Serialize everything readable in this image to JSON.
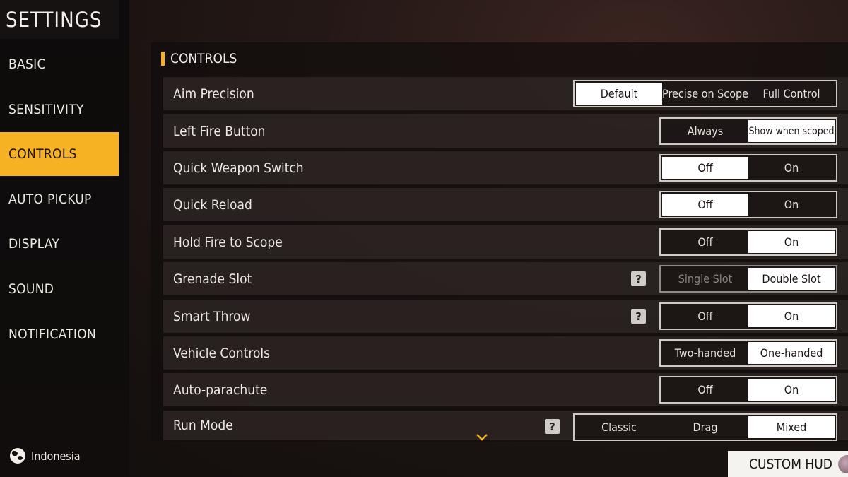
{
  "sidebar": {
    "title": "SETTINGS",
    "items": [
      {
        "label": "BASIC"
      },
      {
        "label": "SENSITIVITY"
      },
      {
        "label": "CONTROLS"
      },
      {
        "label": "AUTO PICKUP"
      },
      {
        "label": "DISPLAY"
      },
      {
        "label": "SOUND"
      },
      {
        "label": "NOTIFICATION"
      }
    ],
    "active_index": 2,
    "region": "Indonesia"
  },
  "section": {
    "title": "CONTROLS"
  },
  "rows": [
    {
      "label": "Aim Precision",
      "help": false,
      "options": [
        "Default",
        "Precise on Scope",
        "Full Control"
      ],
      "selected": 0
    },
    {
      "label": "Left Fire Button",
      "help": false,
      "options": [
        "Always",
        "Show when scoped"
      ],
      "selected": 1
    },
    {
      "label": "Quick Weapon Switch",
      "help": false,
      "options": [
        "Off",
        "On"
      ],
      "selected": 0
    },
    {
      "label": "Quick Reload",
      "help": false,
      "options": [
        "Off",
        "On"
      ],
      "selected": 0
    },
    {
      "label": "Hold Fire to Scope",
      "help": false,
      "options": [
        "Off",
        "On"
      ],
      "selected": 1
    },
    {
      "label": "Grenade Slot",
      "help": true,
      "options": [
        "Single Slot",
        "Double Slot"
      ],
      "selected": 1
    },
    {
      "label": "Smart Throw",
      "help": true,
      "options": [
        "Off",
        "On"
      ],
      "selected": 1
    },
    {
      "label": "Vehicle Controls",
      "help": false,
      "options": [
        "Two-handed",
        "One-handed"
      ],
      "selected": 1
    },
    {
      "label": "Auto-parachute",
      "help": false,
      "options": [
        "Off",
        "On"
      ],
      "selected": 1
    },
    {
      "label": "Run Mode",
      "help": true,
      "options": [
        "Classic",
        "Drag",
        "Mixed"
      ],
      "selected": 2
    }
  ],
  "help_glyph": "?",
  "footer": {
    "custom_hud": "CUSTOM HUD"
  },
  "colors": {
    "accent": "#f6b223",
    "selected_bg": "#ffffff"
  }
}
